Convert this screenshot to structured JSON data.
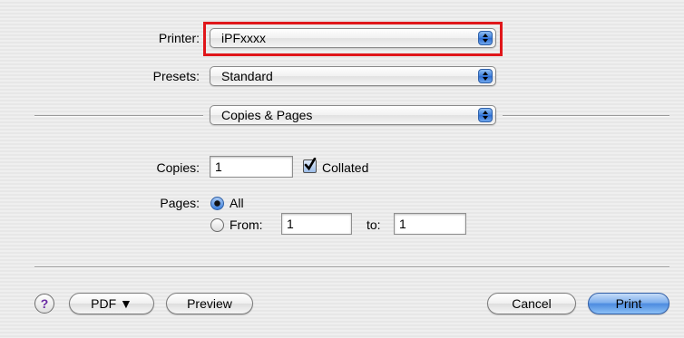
{
  "printer": {
    "label": "Printer:",
    "value": "iPFxxxx",
    "highlight_color": "#e0161a"
  },
  "presets": {
    "label": "Presets:",
    "value": "Standard"
  },
  "section": {
    "value": "Copies & Pages"
  },
  "copies": {
    "label": "Copies:",
    "value": "1",
    "collated_label": "Collated",
    "collated_checked": true
  },
  "pages": {
    "label": "Pages:",
    "all_label": "All",
    "all_selected": true,
    "from_label": "From:",
    "from_value": "1",
    "to_label": "to:",
    "to_value": "1"
  },
  "footer": {
    "help_label": "?",
    "pdf_label": "PDF ▼",
    "preview_label": "Preview",
    "cancel_label": "Cancel",
    "print_label": "Print"
  },
  "colors": {
    "accent": "#3c7fdc",
    "highlight": "#e0161a"
  },
  "icons": {
    "popup_arrows": "updown-arrows-icon",
    "help": "help-icon",
    "checkmark": "checkmark-icon"
  }
}
